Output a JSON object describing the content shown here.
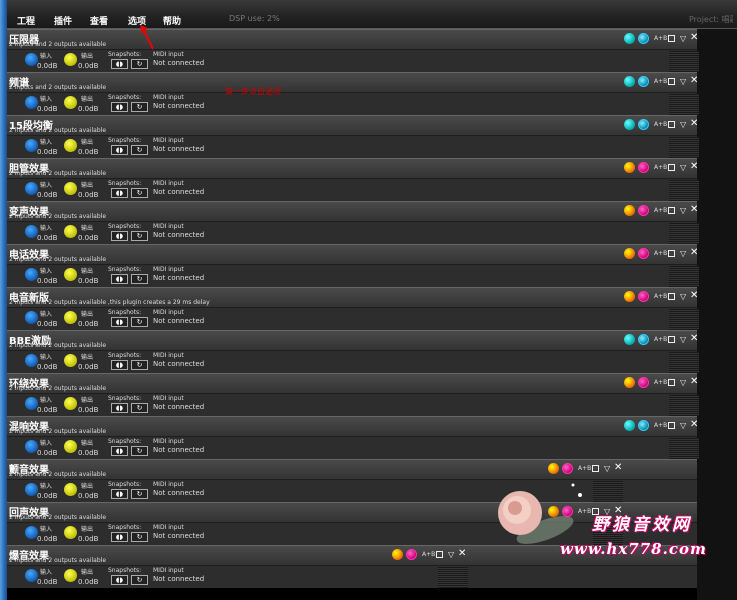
{
  "menu": [
    "工程",
    "插件",
    "查看",
    "选项",
    "帮助"
  ],
  "dsp_use": "DSP use: 2%",
  "project_label": "Project: 唱歌",
  "annotation": "第一步点击选项",
  "labels": {
    "input": "输入",
    "output": "输出",
    "input_value": "0.0dB",
    "output_value": "0.0dB",
    "snapshots": "Snapshots:",
    "midi_input": "MIDI input",
    "midi_status": "Not connected",
    "mode_button": "A+B"
  },
  "plugins": [
    {
      "title": "压限器",
      "subtitle": "2 inputs and 2 outputs available",
      "style": "cool"
    },
    {
      "title": "频谱",
      "subtitle": "2 inputs and 2 outputs available",
      "style": "cool"
    },
    {
      "title": "15段均衡",
      "subtitle": "2 inputs and 2 outputs available",
      "style": "cool"
    },
    {
      "title": "胆管效果",
      "subtitle": "2 inputs and 2 outputs available",
      "style": "warm"
    },
    {
      "title": "变声效果",
      "subtitle": "2 inputs and 2 outputs available",
      "style": "warm"
    },
    {
      "title": "电话效果",
      "subtitle": "2 inputs and 2 outputs available",
      "style": "warm"
    },
    {
      "title": "电音新版",
      "subtitle": "2 inputs and 2 outputs available ,this plugin creates a 29 ms delay",
      "style": "warm"
    },
    {
      "title": "BBE激励",
      "subtitle": "2 inputs and 2 outputs available",
      "style": "cool"
    },
    {
      "title": "环绕效果",
      "subtitle": "2 inputs and 2 outputs available",
      "style": "warm"
    },
    {
      "title": "混响效果",
      "subtitle": "2 inputs and 2 outputs available",
      "style": "cool"
    },
    {
      "title": "颤音效果",
      "subtitle": "2 inputs and 2 outputs available",
      "style": "warm"
    },
    {
      "title": "回声效果",
      "subtitle": "2 inputs and 2 outputs available",
      "style": "warm"
    },
    {
      "title": "爆音效果",
      "subtitle": "2 inputs and 2 outputs available",
      "style": "warm"
    }
  ],
  "watermark": {
    "site_name": "野狼音效网",
    "url": "www.hx778.com"
  }
}
